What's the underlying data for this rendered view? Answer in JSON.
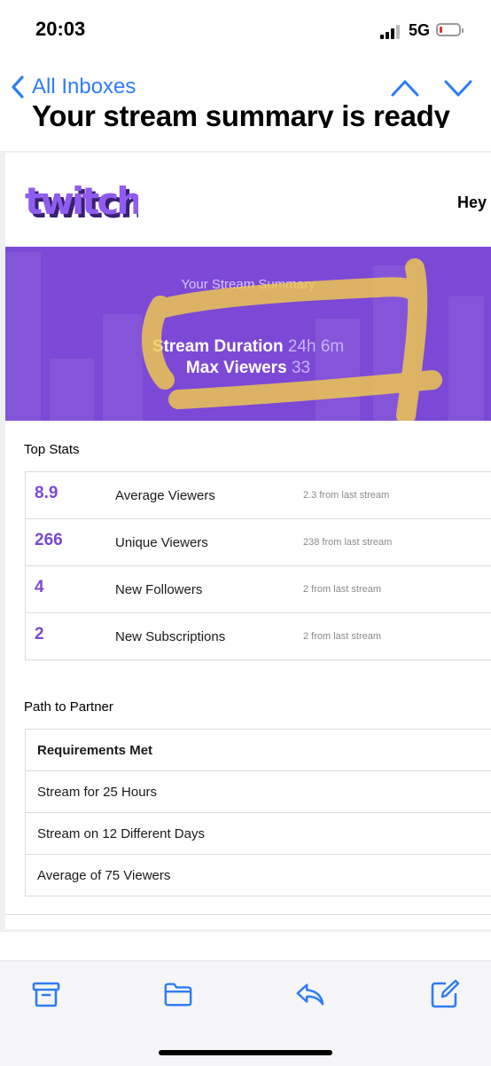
{
  "status_bar": {
    "time": "20:03",
    "network": "5G"
  },
  "nav": {
    "back_label": "All Inboxes"
  },
  "message": {
    "subject": "Your stream summary is ready"
  },
  "email": {
    "brand": "twitch",
    "greeting": "Hey",
    "summary": {
      "title": "Your Stream Summary",
      "duration_label": "Stream Duration",
      "duration_value": "24h 6m",
      "viewers_label": "Max Viewers",
      "viewers_value": "33"
    },
    "top_stats": {
      "heading": "Top Stats",
      "rows": [
        {
          "value": "8.9",
          "label": "Average Viewers",
          "delta": "2.3 from last stream"
        },
        {
          "value": "266",
          "label": "Unique Viewers",
          "delta": "238 from last stream"
        },
        {
          "value": "4",
          "label": "New Followers",
          "delta": "2 from last stream"
        },
        {
          "value": "2",
          "label": "New Subscriptions",
          "delta": "2 from last stream"
        }
      ]
    },
    "path_to_partner": {
      "heading": "Path to Partner",
      "requirements_heading": "Requirements Met",
      "items": [
        "Stream for 25 Hours",
        "Stream on 12 Different Days",
        "Average of 75 Viewers"
      ]
    }
  },
  "toolbar": {
    "icons": [
      "archive-icon",
      "folder-icon",
      "reply-icon",
      "compose-icon"
    ]
  },
  "colors": {
    "accent_blue": "#2f7cf6",
    "twitch_purple": "#7b49d6",
    "highlight_yellow": "#f2c94c",
    "battery_low": "#e0352b"
  }
}
